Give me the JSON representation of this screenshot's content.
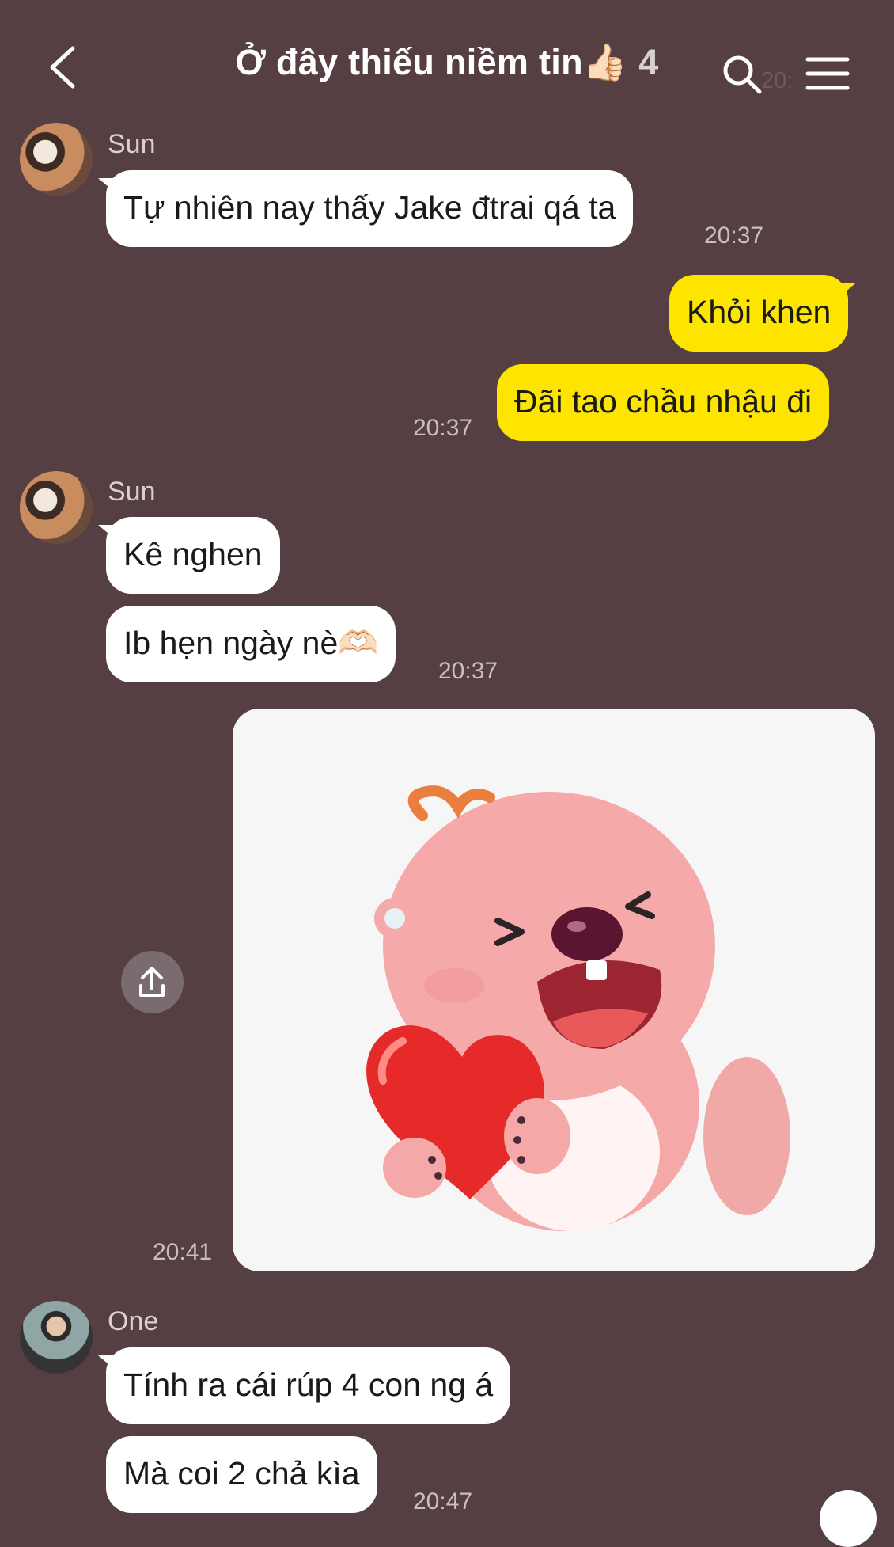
{
  "header": {
    "title": "Ở đây thiếu niềm tin👍🏻",
    "member_count": "4",
    "ghost_time": "20:"
  },
  "messages": {
    "m1": {
      "sender": "Sun",
      "text": "Tự nhiên nay thấy Jake đtrai qá ta",
      "time": "20:37"
    },
    "m2": {
      "text": "Khỏi khen"
    },
    "m3": {
      "text": "Đãi tao chầu nhậu đi",
      "time": "20:37"
    },
    "m4": {
      "sender": "Sun",
      "text": "Kê nghen"
    },
    "m5": {
      "text": "Ib hẹn ngày nè🫶🏻",
      "time": "20:37"
    },
    "m6": {
      "time": "20:41",
      "sticker": "beaver-heart-sticker"
    },
    "m7": {
      "sender": "One",
      "text": "Tính ra cái rúp 4 con ng á"
    },
    "m8": {
      "text": "Mà coi 2 chả kìa",
      "time": "20:47"
    }
  },
  "colors": {
    "background": "#553f42",
    "my_bubble": "#fee500",
    "their_bubble": "#ffffff"
  },
  "icons": [
    "back-icon",
    "search-icon",
    "menu-icon",
    "share-icon"
  ]
}
